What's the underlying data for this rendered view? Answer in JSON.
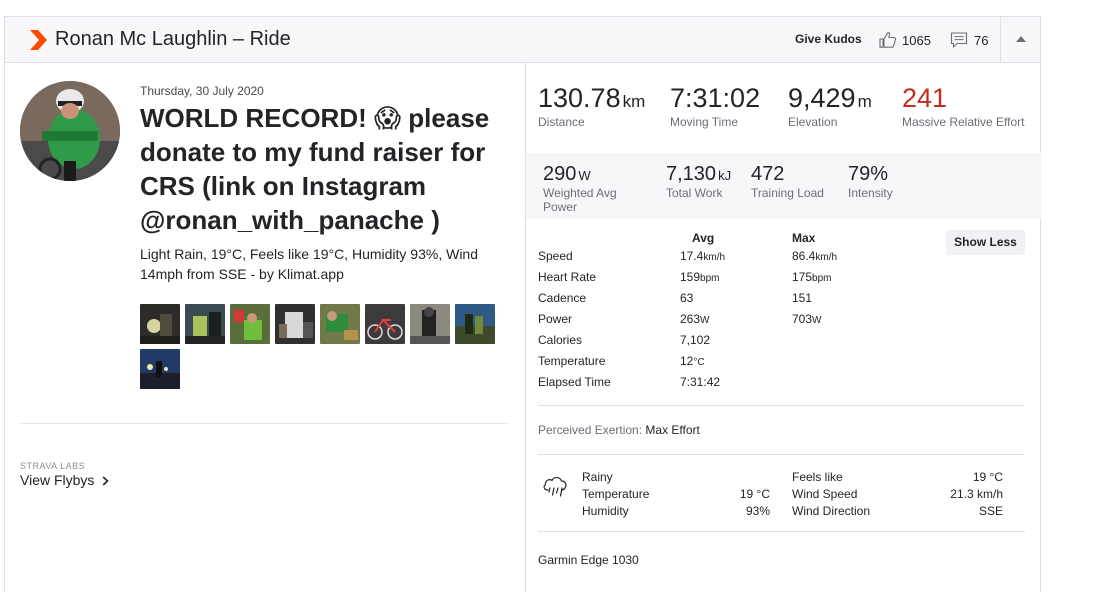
{
  "header": {
    "athlete_title": "Ronan Mc Laughlin – Ride",
    "give_kudos_label": "Give Kudos",
    "kudos_count": "1065",
    "comment_count": "76",
    "brand_color": "#fc4c02"
  },
  "activity": {
    "date": "Thursday, 30 July 2020",
    "name": "WORLD RECORD! 😱 please donate to my fund raiser for CRS (link on Instagram @ronan_with_panache )",
    "description": "Light Rain, 19°C, Feels like 19°C, Humidity 93%, Wind 14mph from SSE - by Klimat.app",
    "photo_count": 9
  },
  "flybys": {
    "labs_label": "STRAVA LABS",
    "link_label": "View Flybys"
  },
  "primary_stats": [
    {
      "value": "130.78",
      "unit": "km",
      "label": "Distance"
    },
    {
      "value": "7:31:02",
      "unit": "",
      "label": "Moving Time"
    },
    {
      "value": "9,429",
      "unit": "m",
      "label": "Elevation"
    },
    {
      "value": "241",
      "unit": "",
      "label": "Massive Relative Effort",
      "color": "#c42c1e"
    }
  ],
  "secondary_stats": [
    {
      "value": "290",
      "unit": "W",
      "label": "Weighted Avg Power"
    },
    {
      "value": "7,130",
      "unit": "kJ",
      "label": "Total Work"
    },
    {
      "value": "472",
      "unit": "",
      "label": "Training Load"
    },
    {
      "value": "79%",
      "unit": "",
      "label": "Intensity"
    }
  ],
  "more_stats": {
    "show_less_label": "Show Less",
    "avg_header": "Avg",
    "max_header": "Max",
    "rows": [
      {
        "label": "Speed",
        "avg": "17.4",
        "avg_unit": "km/h",
        "max": "86.4",
        "max_unit": "km/h"
      },
      {
        "label": "Heart Rate",
        "avg": "159",
        "avg_unit": "bpm",
        "max": "175",
        "max_unit": "bpm"
      },
      {
        "label": "Cadence",
        "avg": "63",
        "avg_unit": "",
        "max": "151",
        "max_unit": ""
      },
      {
        "label": "Power",
        "avg": "263",
        "avg_unit": "W",
        "max": "703",
        "max_unit": "W"
      },
      {
        "label": "Calories",
        "avg": "7,102",
        "avg_unit": "",
        "max": "",
        "max_unit": ""
      },
      {
        "label": "Temperature",
        "avg": "12",
        "avg_unit": "°C",
        "max": "",
        "max_unit": ""
      },
      {
        "label": "Elapsed Time",
        "avg": "7:31:42",
        "avg_unit": "",
        "max": "",
        "max_unit": ""
      }
    ]
  },
  "perceived_exertion": {
    "label": "Perceived Exertion:",
    "value": "Max Effort"
  },
  "weather": {
    "condition": "Rainy",
    "temperature_label": "Temperature",
    "temperature_value": "19 °C",
    "humidity_label": "Humidity",
    "humidity_value": "93%",
    "feels_like_label": "Feels like",
    "feels_like_value": "19 °C",
    "wind_speed_label": "Wind Speed",
    "wind_speed_value": "21.3 km/h",
    "wind_direction_label": "Wind Direction",
    "wind_direction_value": "SSE"
  },
  "device": "Garmin Edge 1030"
}
